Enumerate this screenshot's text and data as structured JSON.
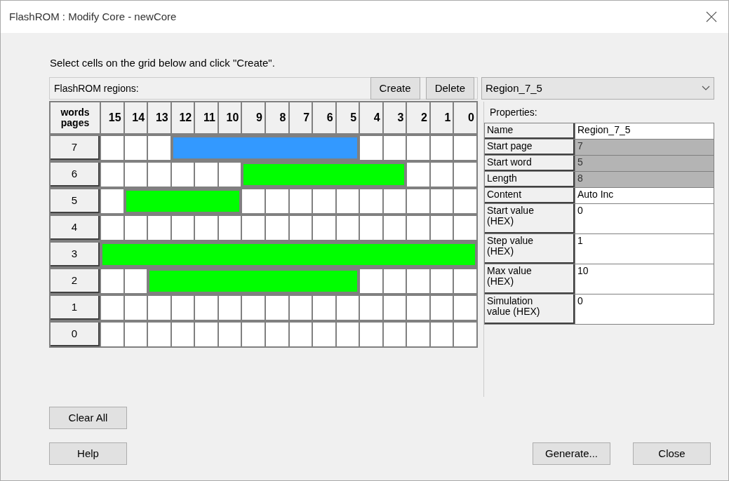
{
  "window": {
    "title": "FlashROM : Modify Core - newCore"
  },
  "instruction": "Select cells on the grid below and click \"Create\".",
  "regions_panel": {
    "label": "FlashROM regions:",
    "buttons": [
      "Create",
      "Delete"
    ]
  },
  "grid": {
    "corner_top": "words",
    "corner_bottom": "pages",
    "columns": [
      "15",
      "14",
      "13",
      "12",
      "11",
      "10",
      "9",
      "8",
      "7",
      "6",
      "5",
      "4",
      "3",
      "2",
      "1",
      "0"
    ],
    "rows": [
      {
        "page": "7",
        "cells": [
          {
            "filled": false
          },
          {
            "filled": false
          },
          {
            "filled": false
          },
          {
            "filled": true,
            "color": "#3399ff"
          },
          {
            "filled": true,
            "color": "#3399ff"
          },
          {
            "filled": true,
            "color": "#3399ff"
          },
          {
            "filled": true,
            "color": "#3399ff"
          },
          {
            "filled": true,
            "color": "#3399ff"
          },
          {
            "filled": true,
            "color": "#3399ff"
          },
          {
            "filled": true,
            "color": "#3399ff"
          },
          {
            "filled": true,
            "color": "#3399ff"
          },
          {
            "filled": false
          },
          {
            "filled": false
          },
          {
            "filled": false
          },
          {
            "filled": false
          },
          {
            "filled": false
          }
        ]
      },
      {
        "page": "6",
        "cells": [
          {
            "filled": false
          },
          {
            "filled": false
          },
          {
            "filled": false
          },
          {
            "filled": false
          },
          {
            "filled": false
          },
          {
            "filled": false
          },
          {
            "filled": true,
            "color": "#00ff00"
          },
          {
            "filled": true,
            "color": "#00ff00"
          },
          {
            "filled": true,
            "color": "#00ff00"
          },
          {
            "filled": true,
            "color": "#00ff00"
          },
          {
            "filled": true,
            "color": "#00ff00"
          },
          {
            "filled": true,
            "color": "#00ff00"
          },
          {
            "filled": true,
            "color": "#00ff00"
          },
          {
            "filled": false
          },
          {
            "filled": false
          },
          {
            "filled": false
          }
        ]
      },
      {
        "page": "5",
        "cells": [
          {
            "filled": false
          },
          {
            "filled": true,
            "color": "#00ff00"
          },
          {
            "filled": true,
            "color": "#00ff00"
          },
          {
            "filled": true,
            "color": "#00ff00"
          },
          {
            "filled": true,
            "color": "#00ff00"
          },
          {
            "filled": true,
            "color": "#00ff00"
          },
          {
            "filled": false
          },
          {
            "filled": false
          },
          {
            "filled": false
          },
          {
            "filled": false
          },
          {
            "filled": false
          },
          {
            "filled": false
          },
          {
            "filled": false
          },
          {
            "filled": false
          },
          {
            "filled": false
          },
          {
            "filled": false
          }
        ]
      },
      {
        "page": "4",
        "cells": [
          {
            "filled": false
          },
          {
            "filled": false
          },
          {
            "filled": false
          },
          {
            "filled": false
          },
          {
            "filled": false
          },
          {
            "filled": false
          },
          {
            "filled": false
          },
          {
            "filled": false
          },
          {
            "filled": false
          },
          {
            "filled": false
          },
          {
            "filled": false
          },
          {
            "filled": false
          },
          {
            "filled": false
          },
          {
            "filled": false
          },
          {
            "filled": false
          },
          {
            "filled": false
          }
        ]
      },
      {
        "page": "3",
        "cells": [
          {
            "filled": true,
            "color": "#00ff00"
          },
          {
            "filled": true,
            "color": "#00ff00"
          },
          {
            "filled": true,
            "color": "#00ff00"
          },
          {
            "filled": true,
            "color": "#00ff00"
          },
          {
            "filled": true,
            "color": "#00ff00"
          },
          {
            "filled": true,
            "color": "#00ff00"
          },
          {
            "filled": true,
            "color": "#00ff00"
          },
          {
            "filled": true,
            "color": "#00ff00"
          },
          {
            "filled": true,
            "color": "#00ff00"
          },
          {
            "filled": true,
            "color": "#00ff00"
          },
          {
            "filled": true,
            "color": "#00ff00"
          },
          {
            "filled": true,
            "color": "#00ff00"
          },
          {
            "filled": true,
            "color": "#00ff00"
          },
          {
            "filled": true,
            "color": "#00ff00"
          },
          {
            "filled": true,
            "color": "#00ff00"
          },
          {
            "filled": true,
            "color": "#00ff00"
          }
        ]
      },
      {
        "page": "2",
        "cells": [
          {
            "filled": false
          },
          {
            "filled": false
          },
          {
            "filled": true,
            "color": "#00ff00"
          },
          {
            "filled": true,
            "color": "#00ff00"
          },
          {
            "filled": true,
            "color": "#00ff00"
          },
          {
            "filled": true,
            "color": "#00ff00"
          },
          {
            "filled": true,
            "color": "#00ff00"
          },
          {
            "filled": true,
            "color": "#00ff00"
          },
          {
            "filled": true,
            "color": "#00ff00"
          },
          {
            "filled": true,
            "color": "#00ff00"
          },
          {
            "filled": true,
            "color": "#00ff00"
          },
          {
            "filled": false
          },
          {
            "filled": false
          },
          {
            "filled": false
          },
          {
            "filled": false
          },
          {
            "filled": false
          }
        ]
      },
      {
        "page": "1",
        "cells": [
          {
            "filled": false
          },
          {
            "filled": false
          },
          {
            "filled": false
          },
          {
            "filled": false
          },
          {
            "filled": false
          },
          {
            "filled": false
          },
          {
            "filled": false
          },
          {
            "filled": false
          },
          {
            "filled": false
          },
          {
            "filled": false
          },
          {
            "filled": false
          },
          {
            "filled": false
          },
          {
            "filled": false
          },
          {
            "filled": false
          },
          {
            "filled": false
          },
          {
            "filled": false
          }
        ]
      },
      {
        "page": "0",
        "cells": [
          {
            "filled": false
          },
          {
            "filled": false
          },
          {
            "filled": false
          },
          {
            "filled": false
          },
          {
            "filled": false
          },
          {
            "filled": false
          },
          {
            "filled": false
          },
          {
            "filled": false
          },
          {
            "filled": false
          },
          {
            "filled": false
          },
          {
            "filled": false
          },
          {
            "filled": false
          },
          {
            "filled": false
          },
          {
            "filled": false
          },
          {
            "filled": false
          },
          {
            "filled": false
          }
        ]
      }
    ]
  },
  "region_select": {
    "value": "Region_7_5"
  },
  "properties": {
    "label": "Properties:",
    "rows": [
      {
        "name": "Name",
        "value": "Region_7_5",
        "disabled": false
      },
      {
        "name": "Start page",
        "value": "7",
        "disabled": true
      },
      {
        "name": "Start word",
        "value": "5",
        "disabled": true
      },
      {
        "name": "Length",
        "value": "8",
        "disabled": true
      },
      {
        "name": "Content",
        "value": "Auto Inc",
        "disabled": false
      },
      {
        "name": "Start value (HEX)",
        "value": "0",
        "disabled": false
      },
      {
        "name": "Step value (HEX)",
        "value": "1",
        "disabled": false
      },
      {
        "name": "Max value (HEX)",
        "value": "10",
        "disabled": false
      },
      {
        "name": "Simulation value (HEX)",
        "value": "0",
        "disabled": false
      }
    ]
  },
  "clear_button": "Clear All",
  "footer_buttons": {
    "left": [
      "Help"
    ],
    "right": [
      "Generate...",
      "Close"
    ]
  }
}
